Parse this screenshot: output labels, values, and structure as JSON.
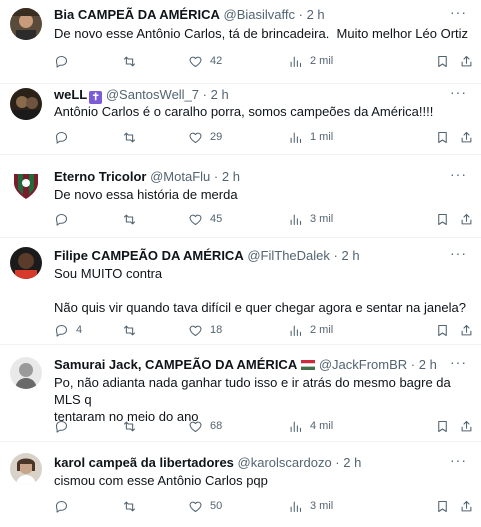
{
  "tweets": [
    {
      "name": "Bia CAMPEÃ DA AMÉRICA",
      "handle": "@Biasilvaffc",
      "time": "2 h",
      "text": "De novo esse Antônio Carlos, tá de brincadeira.  Muito melhor Léo Ortiz",
      "replies": "",
      "retweets": "",
      "likes": "42",
      "views": "2 mil"
    },
    {
      "name": "weLL",
      "badge": "✝",
      "handle": "@SantosWell_7",
      "time": "2 h",
      "text": "Antônio Carlos é o caralho porra, somos campeões da América!!!!",
      "replies": "",
      "retweets": "",
      "likes": "29",
      "views": "1 mil"
    },
    {
      "name": "Eterno Tricolor",
      "handle": "@MotaFlu",
      "time": "2 h",
      "text": "De novo essa história de merda",
      "replies": "",
      "retweets": "",
      "likes": "45",
      "views": "3 mil"
    },
    {
      "name": "Filipe CAMPEÃO DA AMÉRICA",
      "handle": "@FilTheDalek",
      "time": "2 h",
      "text": "Sou MUITO contra\n\nNão quis vir quando tava difícil e quer chegar agora e sentar na janela?",
      "replies": "4",
      "retweets": "",
      "likes": "18",
      "views": "2 mil"
    },
    {
      "name": "Samurai Jack, CAMPEÃO DA AMÉRICA",
      "handle": "@JackFromBR",
      "time": "2 h",
      "text": "Po, não adianta nada ganhar tudo isso e ir atrás do mesmo bagre da MLS q\ntentaram no meio do ano",
      "replies": "",
      "retweets": "",
      "likes": "68",
      "views": "4 mil"
    },
    {
      "name": "karol campeã da libertadores",
      "handle": "@karolscardozo",
      "time": "2 h",
      "text": "cismou com esse Antônio Carlos pqp",
      "replies": "",
      "retweets": "",
      "likes": "50",
      "views": "3 mil"
    }
  ],
  "ui": {
    "dot": "·",
    "more": "···"
  },
  "colors": {
    "text": "#0f1419",
    "muted": "#536471",
    "divider": "#eff3f4"
  }
}
